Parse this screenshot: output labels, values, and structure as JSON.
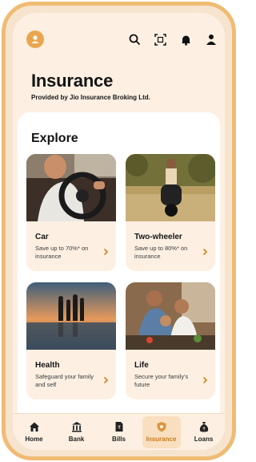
{
  "header": {
    "title": "Insurance",
    "subtitle": "Provided by Jio Insurance Broking Ltd.",
    "icons": [
      "avatar-icon",
      "search-icon",
      "scan-icon",
      "bell-icon",
      "profile-icon"
    ]
  },
  "explore": {
    "heading": "Explore",
    "cards": [
      {
        "name": "Car",
        "desc": "Save up to 70%* on insurance",
        "image": "car-steering-photo"
      },
      {
        "name": "Two-wheeler",
        "desc": "Save up to 80%* on insurance",
        "image": "scooter-rider-photo"
      },
      {
        "name": "Health",
        "desc": "Safeguard your family and self",
        "image": "beach-sunset-family-photo"
      },
      {
        "name": "Life",
        "desc": "Secure your family's future",
        "image": "family-cooking-photo"
      }
    ]
  },
  "nav": {
    "items": [
      {
        "label": "Home",
        "icon": "home-icon"
      },
      {
        "label": "Bank",
        "icon": "bank-icon"
      },
      {
        "label": "Bills",
        "icon": "bills-icon"
      },
      {
        "label": "Insurance",
        "icon": "shield-icon"
      },
      {
        "label": "Loans",
        "icon": "loan-bag-icon"
      }
    ],
    "active": "Insurance"
  },
  "colors": {
    "accent": "#e9a64f",
    "active_label": "#c77c1f",
    "background": "#fdf0e3",
    "frame": "#efbc74"
  }
}
